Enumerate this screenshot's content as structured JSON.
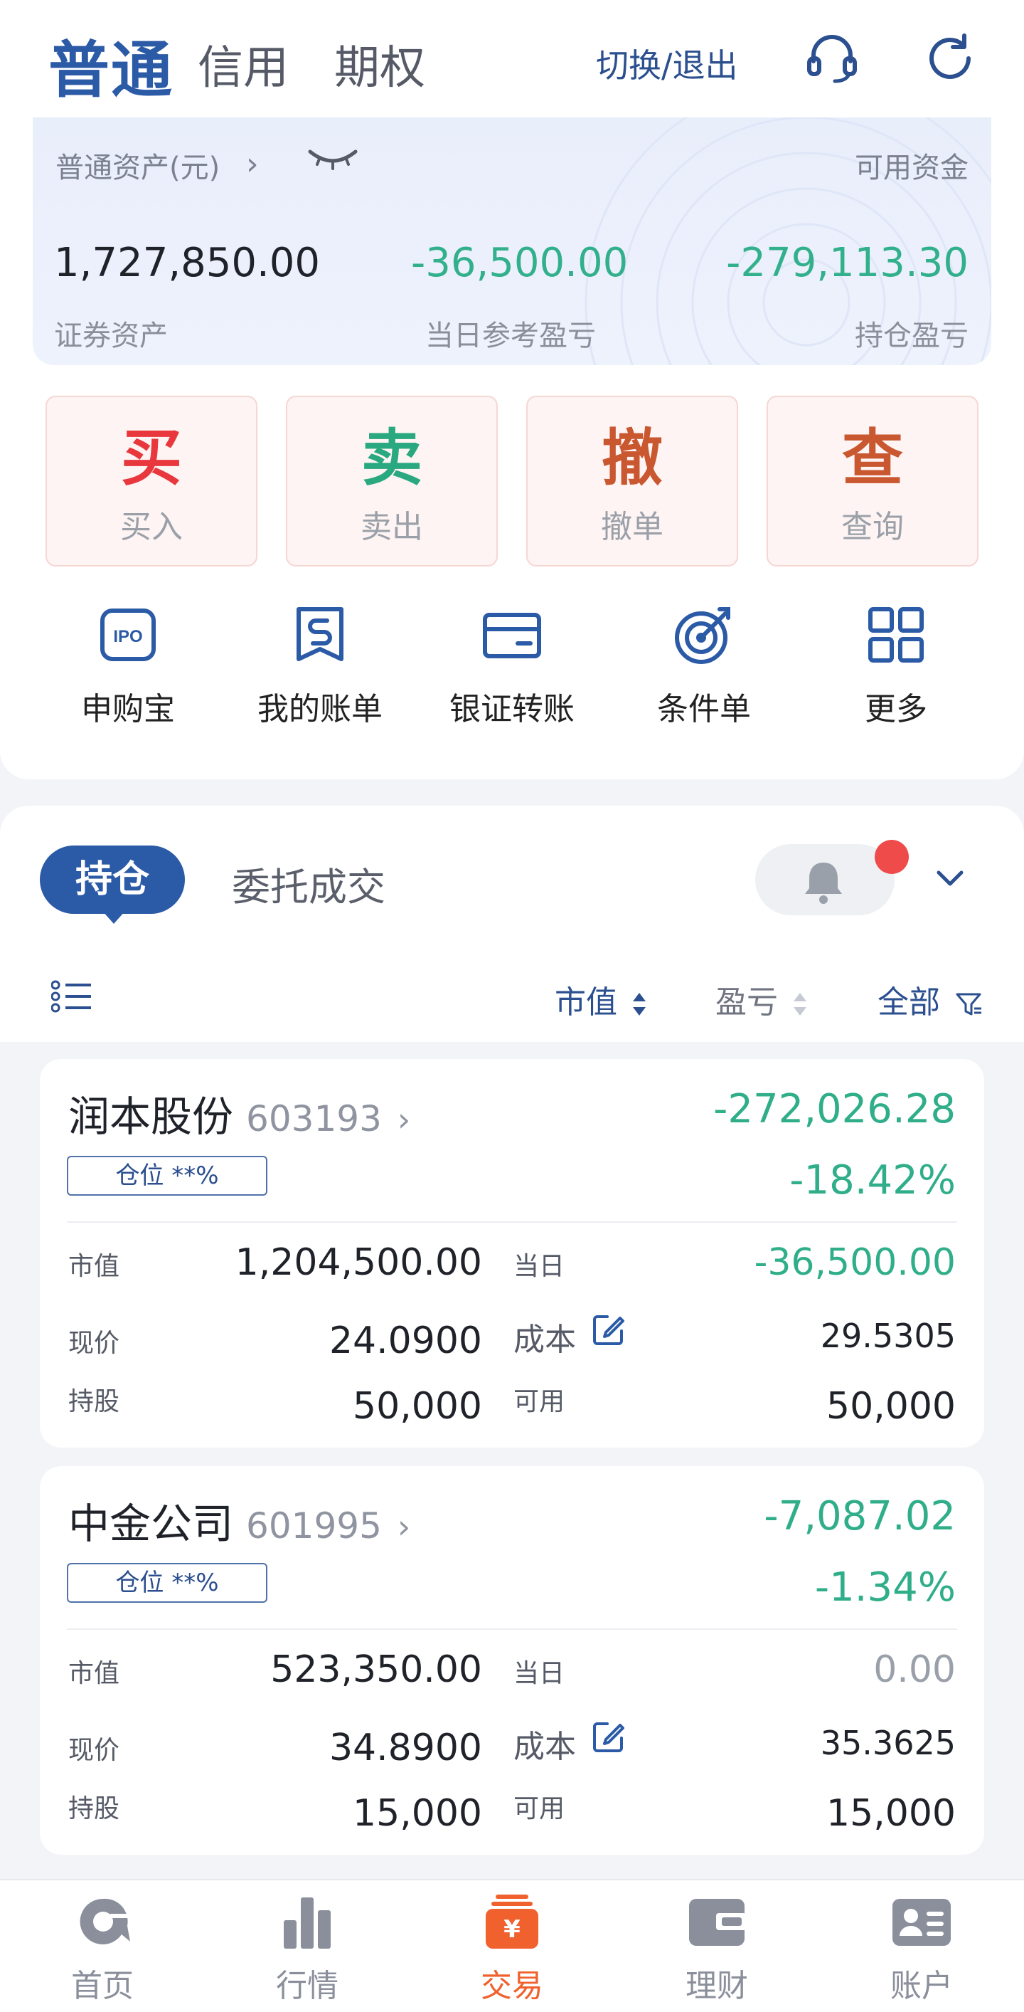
{
  "header": {
    "tab_normal": "普通",
    "tab_credit": "信用",
    "tab_option": "期权",
    "switch_exit": "切换/退出"
  },
  "asset": {
    "label": "普通资产(元)",
    "available_label": "可用资金",
    "securities_value": "1,727,850.00",
    "securities_label": "证券资产",
    "today_pl_value": "-36,500.00",
    "today_pl_label": "当日参考盈亏",
    "holding_pl_value": "-279,113.30",
    "holding_pl_label": "持仓盈亏"
  },
  "actions": [
    {
      "big": "买",
      "small": "买入"
    },
    {
      "big": "卖",
      "small": "卖出"
    },
    {
      "big": "撤",
      "small": "撤单"
    },
    {
      "big": "查",
      "small": "查询"
    }
  ],
  "shortcuts": [
    {
      "label": "申购宝",
      "icon": "ipo-icon",
      "icon_text": "IPO"
    },
    {
      "label": "我的账单",
      "icon": "bill-icon"
    },
    {
      "label": "银证转账",
      "icon": "bank-transfer-icon"
    },
    {
      "label": "条件单",
      "icon": "target-icon"
    },
    {
      "label": "更多",
      "icon": "grid-icon"
    }
  ],
  "holdings_tabs": {
    "active": "持仓",
    "other": "委托成交"
  },
  "sort_bar": {
    "market_value": "市值",
    "profit_loss": "盈亏",
    "all": "全部"
  },
  "stocks": [
    {
      "name": "润本股份",
      "code": "603193",
      "pl": "-272,026.28",
      "pl_pct": "-18.42%",
      "position": "仓位 **%",
      "market_value_label": "市值",
      "market_value": "1,204,500.00",
      "today_label": "当日",
      "today": "-36,500.00",
      "price_label": "现价",
      "price": "24.0900",
      "cost_label": "成本",
      "cost": "29.5305",
      "shares_label": "持股",
      "shares": "50,000",
      "available_label": "可用",
      "available": "50,000"
    },
    {
      "name": "中金公司",
      "code": "601995",
      "pl": "-7,087.02",
      "pl_pct": "-1.34%",
      "position": "仓位 **%",
      "market_value_label": "市值",
      "market_value": "523,350.00",
      "today_label": "当日",
      "today": "0.00",
      "price_label": "现价",
      "price": "34.8900",
      "cost_label": "成本",
      "cost": "35.3625",
      "shares_label": "持股",
      "shares": "15,000",
      "available_label": "可用",
      "available": "15,000"
    }
  ],
  "bottom_nav": [
    {
      "label": "首页"
    },
    {
      "label": "行情"
    },
    {
      "label": "交易"
    },
    {
      "label": "理财"
    },
    {
      "label": "账户"
    }
  ],
  "colors": {
    "brand_blue": "#2b5aa6",
    "loss_green": "#2fae89",
    "buy_red": "#e8383d",
    "active_orange": "#f0612d"
  }
}
